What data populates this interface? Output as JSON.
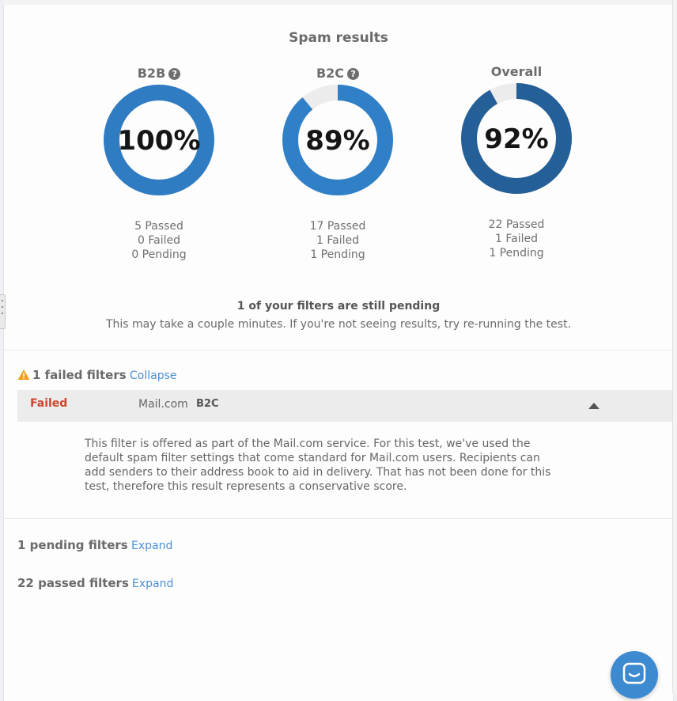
{
  "title": "Spam results",
  "gauges": [
    {
      "label": "B2B",
      "percent_text": "100%",
      "fraction": 1.0,
      "help": "?",
      "passed": "5 Passed",
      "failed": "0 Failed",
      "pending": "0 Pending"
    },
    {
      "label": "B2C",
      "percent_text": "89%",
      "fraction": 0.89,
      "help": "?",
      "passed": "17 Passed",
      "failed": "1 Failed",
      "pending": "1 Pending"
    },
    {
      "label": "Overall",
      "percent_text": "92%",
      "fraction": 0.92,
      "passed": "22 Passed",
      "failed": "1 Failed",
      "pending": "1 Pending"
    }
  ],
  "colors": {
    "ring_b2b": "#2f7cc2",
    "ring_b2c": "#3080c7",
    "ring_overall": "#245f97",
    "ring_track": "#ececec",
    "failed": "#d0452f",
    "link": "#4a8fd4",
    "warning": "#f0a020"
  },
  "pending_notice": {
    "title": "1 of your filters are still pending",
    "subtitle": "This may take a couple minutes. If you're not seeing results, try re-running the test."
  },
  "failed_section": {
    "heading": "1 failed filters",
    "toggle": "Collapse",
    "row": {
      "status": "Failed",
      "client": "Mail.com",
      "segment": "B2C"
    },
    "description": "This filter is offered as part of the Mail.com service. For this test, we've used the default spam filter settings that come standard for Mail.com users. Recipients can add senders to their address book to aid in delivery. That has not been done for this test, therefore this result represents a conservative score."
  },
  "pending_section": {
    "heading": "1 pending filters",
    "toggle": "Expand"
  },
  "passed_section": {
    "heading": "22 passed filters",
    "toggle": "Expand"
  },
  "icons": {
    "help": "question-circle-icon",
    "warning": "warning-triangle-icon",
    "caret": "caret-up-icon",
    "chat": "chat-bubble-icon"
  }
}
